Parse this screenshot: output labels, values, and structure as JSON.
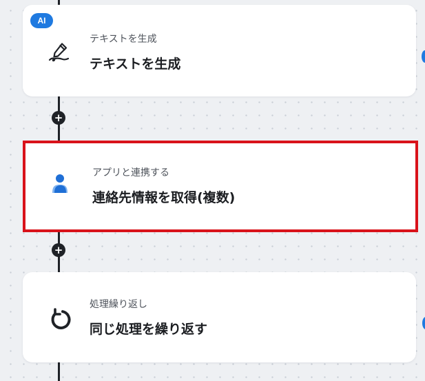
{
  "flow": {
    "nodes": [
      {
        "badge": "AI",
        "subtitle": "テキストを生成",
        "title": "テキストを生成",
        "icon": "pen-write-icon",
        "selected": false
      },
      {
        "subtitle": "アプリと連携する",
        "title": "連絡先情報を取得(複数)",
        "icon": "person-icon",
        "selected": true
      },
      {
        "subtitle": "処理繰り返し",
        "title": "同じ処理を繰り返す",
        "icon": "loop-icon",
        "selected": false
      }
    ],
    "add_node_label": "+"
  },
  "colors": {
    "canvas_bg": "#eef0f3",
    "card_bg": "#ffffff",
    "accent_blue": "#1f7ae0",
    "selection_red": "#d9121a",
    "connector": "#1f2227"
  }
}
